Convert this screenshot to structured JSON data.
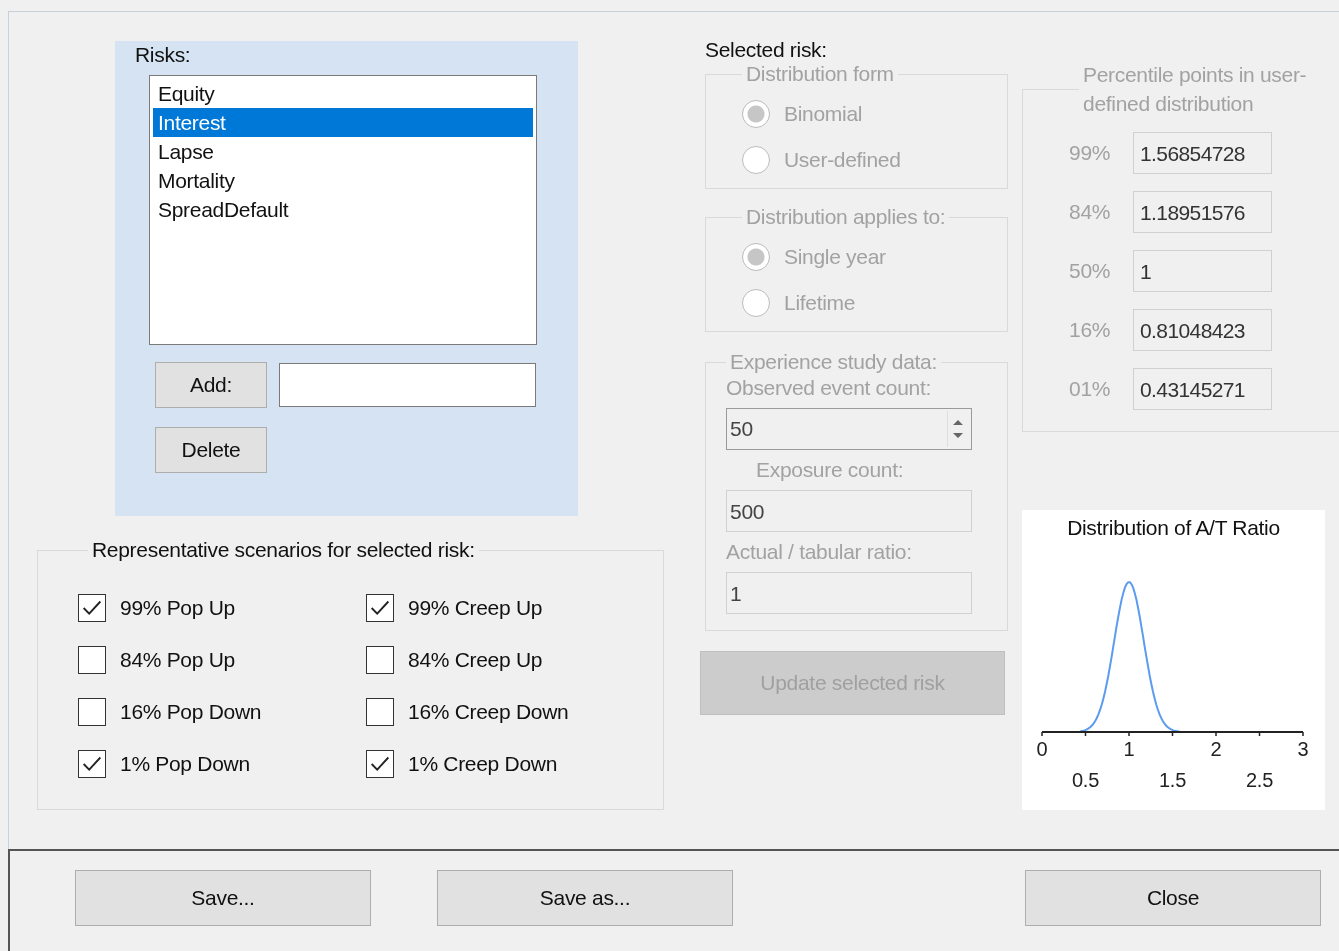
{
  "risks": {
    "label": "Risks:",
    "items": [
      {
        "text": "Equity",
        "selected": false
      },
      {
        "text": "Interest",
        "selected": true
      },
      {
        "text": "Lapse",
        "selected": false
      },
      {
        "text": "Mortality",
        "selected": false
      },
      {
        "text": "SpreadDefault",
        "selected": false
      }
    ],
    "add_button": "Add:",
    "delete_button": "Delete"
  },
  "scenarios": {
    "title": "Representative scenarios for selected risk:",
    "items": [
      {
        "label": "99% Pop Up",
        "checked": true
      },
      {
        "label": "99% Creep Up",
        "checked": true
      },
      {
        "label": "84% Pop Up",
        "checked": false
      },
      {
        "label": "84% Creep Up",
        "checked": false
      },
      {
        "label": "16% Pop Down",
        "checked": false
      },
      {
        "label": "16% Creep Down",
        "checked": false
      },
      {
        "label": "1% Pop Down",
        "checked": true
      },
      {
        "label": "1% Creep Down",
        "checked": true
      }
    ]
  },
  "selected_risk": {
    "title": "Selected risk:",
    "disabled": true,
    "distribution_form": {
      "title": "Distribution form",
      "options": [
        {
          "label": "Binomial",
          "selected": true
        },
        {
          "label": "User-defined",
          "selected": false
        }
      ]
    },
    "applies_to": {
      "title": "Distribution applies to:",
      "options": [
        {
          "label": "Single year",
          "selected": true
        },
        {
          "label": "Lifetime",
          "selected": false
        }
      ]
    },
    "experience": {
      "title": "Experience study data:",
      "observed_label": "Observed event count:",
      "observed_value": "50",
      "exposure_label": "Exposure count:",
      "exposure_value": "500",
      "ratio_label": "Actual / tabular ratio:",
      "ratio_value": "1"
    },
    "update_button": "Update selected risk"
  },
  "percentiles": {
    "title": "Percentile points in user-defined distribution",
    "disabled": true,
    "rows": [
      {
        "label": "99%",
        "value": "1.56854728"
      },
      {
        "label": "84%",
        "value": "1.18951576"
      },
      {
        "label": "50%",
        "value": "1"
      },
      {
        "label": "16%",
        "value": "0.81048423"
      },
      {
        "label": "01%",
        "value": "0.43145271"
      }
    ]
  },
  "chart": {
    "title": "Distribution of A/T Ratio",
    "tick_labels": [
      "0",
      "0.5",
      "1",
      "1.5",
      "2",
      "2.5",
      "3"
    ]
  },
  "footer": {
    "buttons": [
      "Save...",
      "Save as...",
      "Close"
    ]
  }
}
